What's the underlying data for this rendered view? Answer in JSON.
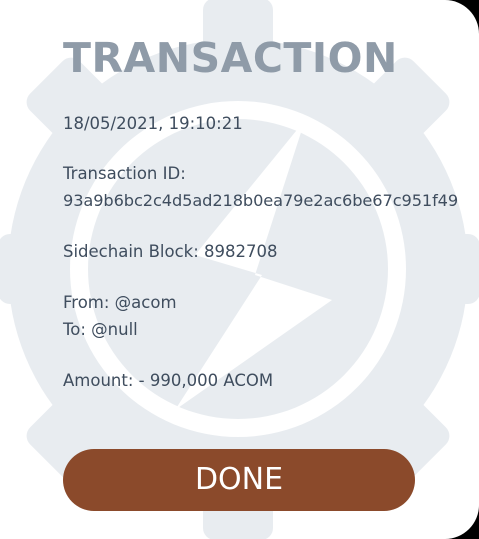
{
  "colors": {
    "backdrop": "#000000",
    "dialog_background": "#ffffff",
    "title": "#8f9ba8",
    "body_text": "#3f4d5e",
    "watermark": "#e8ecf0",
    "done_button_bg": "#8b4a2b",
    "done_button_text": "#ffffff"
  },
  "dialog": {
    "title": "TRANSACTION",
    "timestamp": "18/05/2021, 19:10:21",
    "transaction_id_label": "Transaction ID:",
    "transaction_id": "93a9b6bc2c4d5ad218b0ea79e2ac6be67c951f49",
    "sidechain_block": "Sidechain Block: 8982708",
    "from": "From: @acom",
    "to": "To: @null",
    "amount": "Amount: - 990,000 ACOM",
    "done_label": "DONE",
    "watermark_icon": "gear-lightning-logo-icon"
  }
}
